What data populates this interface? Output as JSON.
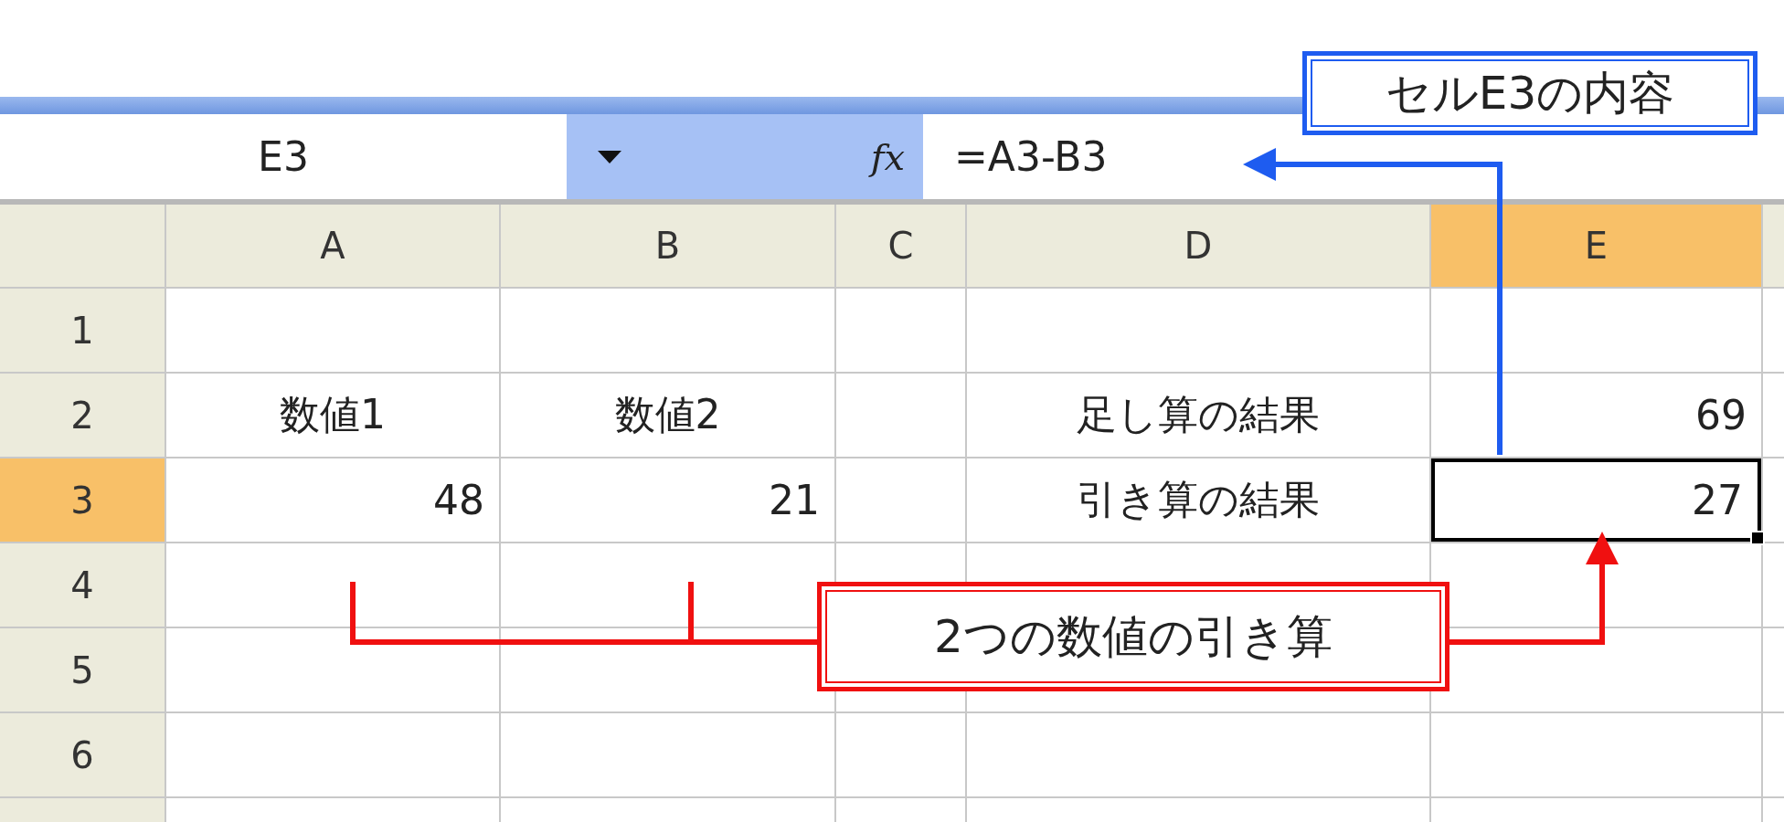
{
  "name_box": {
    "value": "E3"
  },
  "formula_bar": {
    "fx_label": "fx",
    "formula": "=A3-B3"
  },
  "columns": [
    {
      "label": "A",
      "selected": false
    },
    {
      "label": "B",
      "selected": false
    },
    {
      "label": "C",
      "selected": false
    },
    {
      "label": "D",
      "selected": false
    },
    {
      "label": "E",
      "selected": true
    }
  ],
  "rows": [
    {
      "label": "1",
      "selected": false,
      "cells": [
        null,
        null,
        null,
        null,
        null
      ]
    },
    {
      "label": "2",
      "selected": false,
      "cells": [
        {
          "text": "数値1",
          "kind": "text"
        },
        {
          "text": "数値2",
          "kind": "text"
        },
        null,
        {
          "text": "足し算の結果",
          "kind": "text"
        },
        {
          "text": "69",
          "kind": "number"
        }
      ]
    },
    {
      "label": "3",
      "selected": true,
      "cells": [
        {
          "text": "48",
          "kind": "number"
        },
        {
          "text": "21",
          "kind": "number"
        },
        null,
        {
          "text": "引き算の結果",
          "kind": "text"
        },
        {
          "text": "27",
          "kind": "number"
        }
      ]
    },
    {
      "label": "4",
      "selected": false,
      "cells": [
        null,
        null,
        null,
        null,
        null
      ]
    },
    {
      "label": "5",
      "selected": false,
      "cells": [
        null,
        null,
        null,
        null,
        null
      ]
    },
    {
      "label": "6",
      "selected": false,
      "cells": [
        null,
        null,
        null,
        null,
        null
      ]
    }
  ],
  "callouts": [
    {
      "text": "セルE3の内容",
      "color": "#1e5cf0"
    },
    {
      "text": "2つの数値の引き算",
      "color": "#f01010"
    }
  ]
}
